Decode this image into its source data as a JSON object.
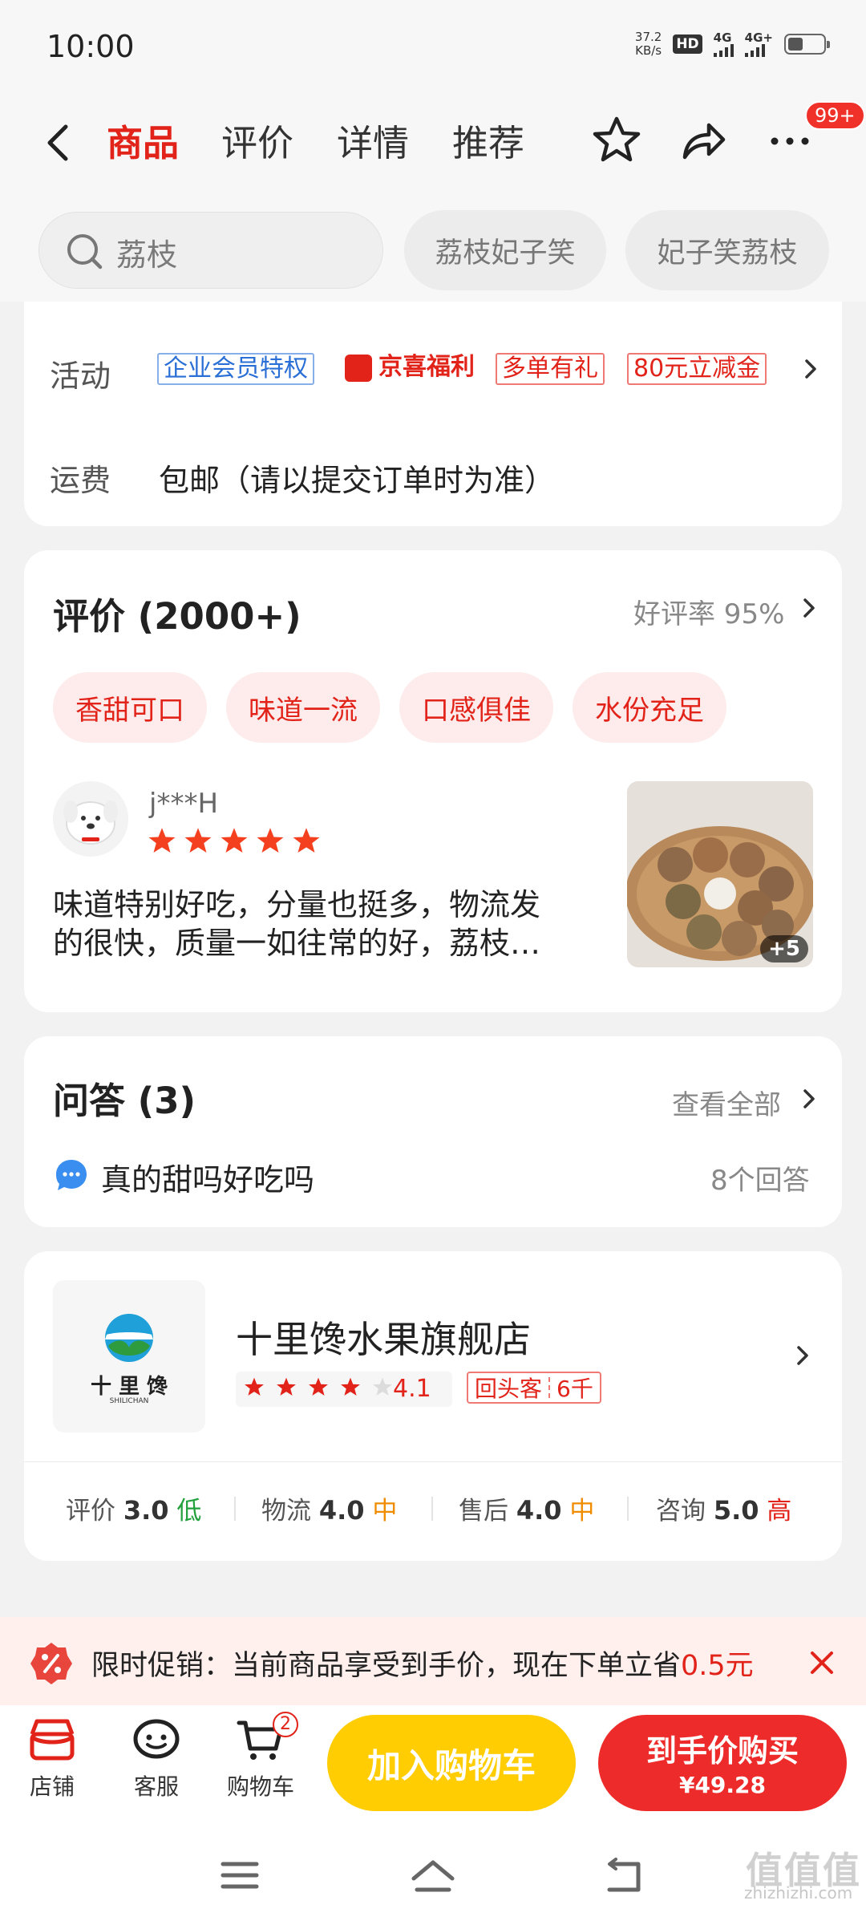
{
  "status_bar": {
    "time": "10:00",
    "speed_value": "37.2",
    "speed_unit": "KB/s",
    "hd_label": "HD",
    "signal1_label": "4G",
    "signal2_label": "4G+"
  },
  "nav": {
    "tabs": [
      "商品",
      "评价",
      "详情",
      "推荐"
    ],
    "active_tab": "商品",
    "more_badge": "99+",
    "icons": [
      "back-icon",
      "star-icon",
      "share-icon",
      "more-icon"
    ]
  },
  "search": {
    "value": "荔枝",
    "chips": [
      "荔枝妃子笑",
      "妃子笑荔枝"
    ]
  },
  "info_card": {
    "activity_label": "活动",
    "activity_tags": [
      "企业会员特权",
      "京喜福利",
      "多单有礼",
      "80元立减金"
    ],
    "shipping_label": "运费",
    "shipping_value": "包邮（请以提交订单时为准）"
  },
  "reviews": {
    "title": "评价 (2000+)",
    "good_rate": "好评率 95%",
    "keywords": [
      "香甜可口",
      "味道一流",
      "口感俱佳",
      "水份充足"
    ],
    "user": "j***H",
    "stars": 5,
    "text_line1": "味道特别好吃，分量也挺多，物流发",
    "text_line2": "的很快，质量一如往常的好，荔枝…",
    "image_more": "+5"
  },
  "qa": {
    "title": "问答 (3)",
    "view_all": "查看全部",
    "question": "真的甜吗好吃吗",
    "answer_count": "8个回答"
  },
  "store": {
    "name": "十里馋水果旗舰店",
    "logo_text": "十 里 馋",
    "logo_subtext": "SHILICHAN",
    "rating": "4.1",
    "rating_value": 4.1,
    "repeat_label": "回头客",
    "repeat_count": "6千",
    "scores": [
      {
        "label": "评价",
        "value": "3.0",
        "level": "低"
      },
      {
        "label": "物流",
        "value": "4.0",
        "level": "中"
      },
      {
        "label": "售后",
        "value": "4.0",
        "level": "中"
      },
      {
        "label": "咨询",
        "value": "5.0",
        "level": "高"
      }
    ]
  },
  "promo": {
    "text": "限时促销：当前商品享受到手价，现在下单立省",
    "amount": "0.5元"
  },
  "bottom_bar": {
    "store_label": "店铺",
    "service_label": "客服",
    "cart_label": "购物车",
    "cart_count": "2",
    "add_cart": "加入购物车",
    "buy_now": "到手价购买",
    "buy_price": "¥49.28"
  },
  "watermark": {
    "glyphs": "值值值",
    "text": "zhizhizhi.com"
  },
  "colors": {
    "accent_red": "#e2231a",
    "yellow": "#ffcd02",
    "buy_red": "#ee2b2b"
  }
}
